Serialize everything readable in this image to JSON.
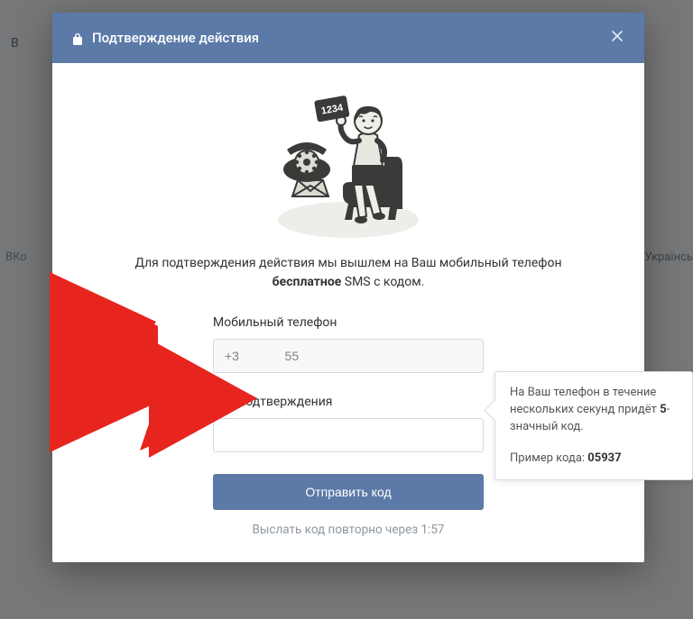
{
  "background": {
    "left_text": "В",
    "footer_left": "ВКо",
    "footer_right": "усский  Українсь"
  },
  "modal": {
    "title": "Подтверждение действия",
    "illustration_code": "1234",
    "description_line1": "Для подтверждения действия мы вышлем на Ваш мобильный телефон",
    "description_bold": "бесплатное",
    "description_line2_suffix": " SMS с кодом.",
    "phone_label": "Мобильный телефон",
    "phone_value": "+3             55",
    "code_label": "Код подтверждения",
    "code_value": "",
    "submit_label": "Отправить код",
    "resend_text": "Выслать код повторно через 1:57",
    "tooltip_text_prefix": "На Ваш телефон в течение нескольких секунд придёт ",
    "tooltip_digits": "5",
    "tooltip_text_suffix": "-значный код.",
    "tooltip_example_label": "Пример кода: ",
    "tooltip_example_code": "05937"
  }
}
